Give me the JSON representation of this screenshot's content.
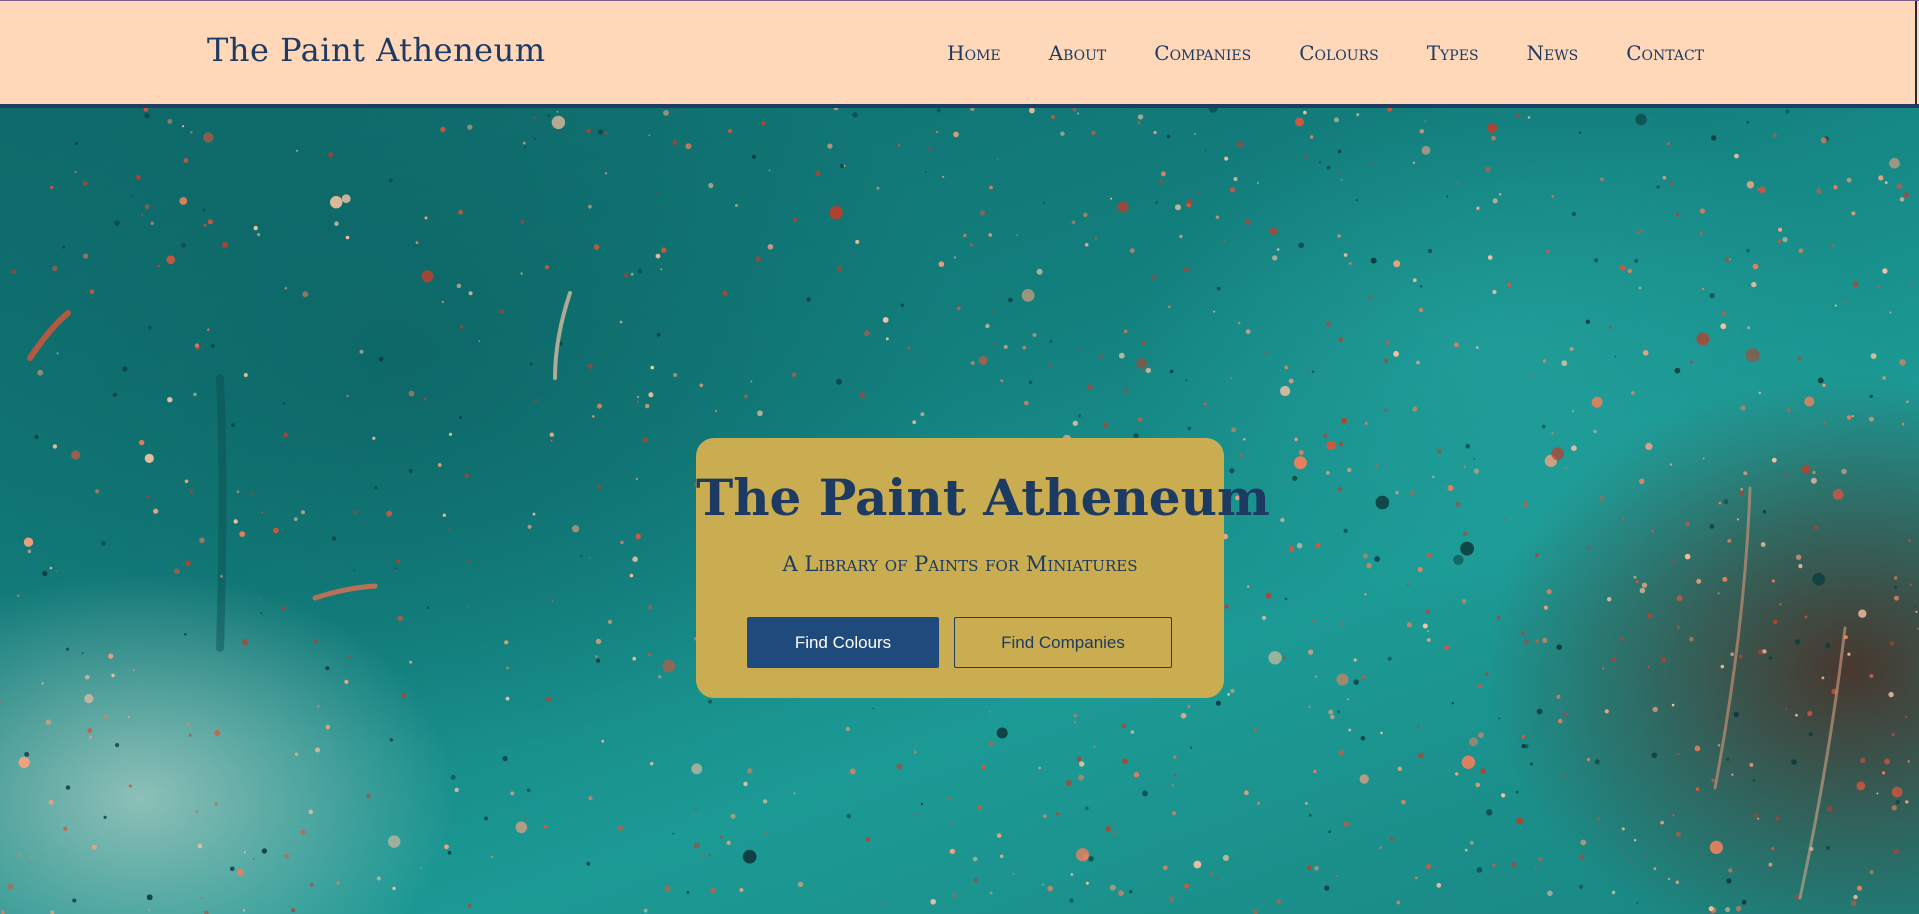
{
  "header": {
    "brand": "The Paint Atheneum",
    "nav": [
      {
        "label": "Home"
      },
      {
        "label": "About"
      },
      {
        "label": "Companies"
      },
      {
        "label": "Colours"
      },
      {
        "label": "Types"
      },
      {
        "label": "News"
      },
      {
        "label": "Contact"
      }
    ]
  },
  "hero": {
    "title": "The Paint Atheneum",
    "subtitle": "A Library of Paints for Miniatures",
    "primary_button": "Find Colours",
    "secondary_button": "Find Companies"
  },
  "colors": {
    "header_bg": "#ffd7b9",
    "brand_text": "#1d3a63",
    "card_bg": "#c9ad50",
    "primary_button_bg": "#1f4a7c",
    "hero_bg": "#1f8a86"
  }
}
